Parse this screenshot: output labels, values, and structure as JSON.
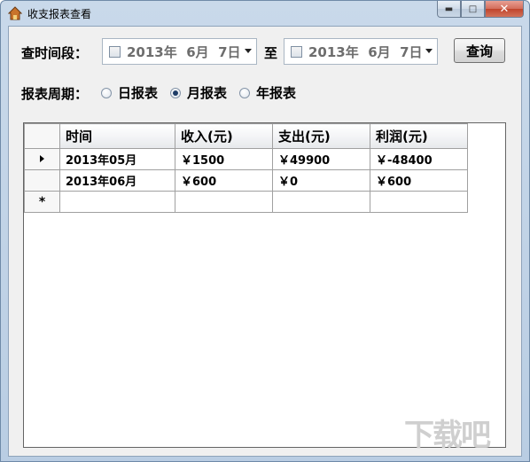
{
  "window": {
    "title": "收支报表查看",
    "controls": {
      "minimize": "▬",
      "maximize": "□",
      "close": "✕"
    }
  },
  "filters": {
    "period_label": "查时间段：",
    "start_date": "2013年  6月  7日",
    "to_label": "至",
    "end_date": "2013年  6月  7日",
    "query_button": "查询",
    "cycle_label": "报表周期：",
    "cycle_options": [
      {
        "label": "日报表",
        "selected": false
      },
      {
        "label": "月报表",
        "selected": true
      },
      {
        "label": "年报表",
        "selected": false
      }
    ]
  },
  "table": {
    "columns": [
      "时间",
      "收入(元)",
      "支出(元)",
      "利润(元)"
    ],
    "rows": [
      {
        "current": true,
        "cells": [
          "2013年05月",
          "￥1500",
          "￥49900",
          "￥-48400"
        ]
      },
      {
        "current": false,
        "cells": [
          "2013年06月",
          "￥600",
          "￥0",
          "￥600"
        ]
      }
    ],
    "new_row_marker": "*"
  },
  "watermark": "下载吧"
}
